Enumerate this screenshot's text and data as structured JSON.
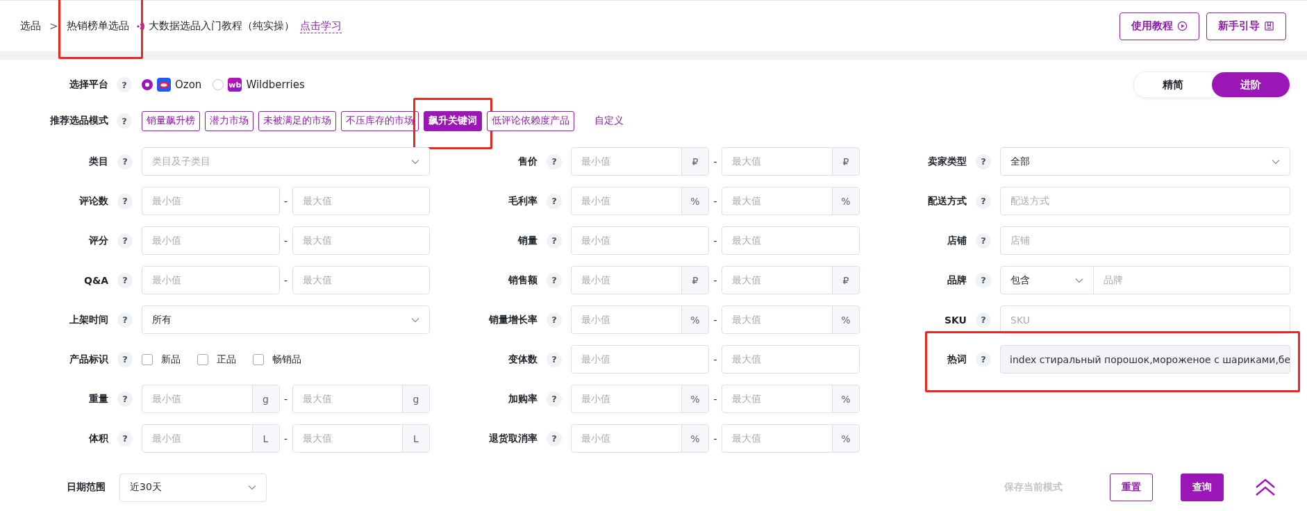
{
  "breadcrumb": {
    "items": [
      {
        "label": "选品",
        "highlighted": false
      },
      {
        "label": "热销榜单选品",
        "highlighted": true
      }
    ],
    "separator": ">"
  },
  "tutorial": {
    "title": "大数据选品入门教程（纯实操）",
    "link": "点击学习"
  },
  "header_buttons": [
    {
      "label": "使用教程",
      "kind": "play"
    },
    {
      "label": "新手引导",
      "kind": "guide"
    }
  ],
  "platform": {
    "label": "选择平台",
    "help": "?",
    "options": [
      {
        "name": "Ozon",
        "kind": "ozon",
        "selected": true
      },
      {
        "name": "Wildberries",
        "kind": "wb",
        "logo_text": "wb",
        "selected": false
      }
    ]
  },
  "view_toggle": [
    {
      "label": "精简",
      "selected": false
    },
    {
      "label": "进阶",
      "selected": true
    }
  ],
  "modes": {
    "label": "推荐选品模式",
    "help": "?",
    "items": [
      {
        "label": "销量飙升榜",
        "kind": "tag",
        "selected": false,
        "highlighted": false
      },
      {
        "label": "潜力市场",
        "kind": "tag",
        "selected": false,
        "highlighted": false
      },
      {
        "label": "未被满足的市场",
        "kind": "tag",
        "selected": false,
        "highlighted": false
      },
      {
        "label": "不压库存的市场",
        "kind": "tag",
        "selected": false,
        "highlighted": false
      },
      {
        "label": "飙升关键词",
        "kind": "tag",
        "selected": true,
        "highlighted": true
      },
      {
        "label": "低评论依赖度产品",
        "kind": "tag",
        "selected": false,
        "highlighted": false
      },
      {
        "label": "自定义",
        "kind": "link",
        "selected": false,
        "highlighted": false
      }
    ]
  },
  "filters": [
    {
      "rows": [
        {
          "label": "类目",
          "help": "?",
          "kind": "select",
          "placeholder": "类目及子类目"
        },
        {
          "label": "评论数",
          "help": "?",
          "kind": "range",
          "min": "最小值",
          "separator": "-",
          "max": "最大值"
        },
        {
          "label": "评分",
          "help": "?",
          "kind": "range",
          "min": "最小值",
          "separator": "-",
          "max": "最大值"
        },
        {
          "label": "Q&A",
          "help": "?",
          "kind": "range",
          "min": "最小值",
          "separator": "-",
          "max": "最大值"
        },
        {
          "label": "上架时间",
          "help": "?",
          "kind": "select",
          "value": "所有"
        },
        {
          "label": "产品标识",
          "help": "?",
          "kind": "checks",
          "options": [
            {
              "label": "新品",
              "checked": false
            },
            {
              "label": "正品",
              "checked": false
            },
            {
              "label": "畅销品",
              "checked": false
            }
          ]
        },
        {
          "label": "重量",
          "help": "?",
          "kind": "range",
          "min": "最小值",
          "min_unit": "g",
          "separator": "-",
          "max": "最大值",
          "max_unit": "g"
        },
        {
          "label": "体积",
          "help": "?",
          "kind": "range",
          "min": "最小值",
          "min_unit": "L",
          "separator": "-",
          "max": "最大值",
          "max_unit": "L"
        }
      ]
    },
    {
      "rows": [
        {
          "label": "售价",
          "help": "?",
          "kind": "range",
          "min": "最小值",
          "min_unit": "₽",
          "separator": "-",
          "max": "最大值",
          "max_unit": "₽"
        },
        {
          "label": "毛利率",
          "help": "?",
          "kind": "range",
          "min": "最小值",
          "min_unit": "%",
          "separator": "-",
          "max": "最大值",
          "max_unit": "%"
        },
        {
          "label": "销量",
          "help": "?",
          "kind": "range",
          "min": "最小值",
          "separator": "-",
          "max": "最大值"
        },
        {
          "label": "销售额",
          "help": "?",
          "kind": "range",
          "min": "最小值",
          "min_unit": "₽",
          "separator": "-",
          "max": "最大值",
          "max_unit": "₽"
        },
        {
          "label": "销量增长率",
          "help": "?",
          "kind": "range",
          "min": "最小值",
          "min_unit": "%",
          "separator": "-",
          "max": "最大值",
          "max_unit": "%"
        },
        {
          "label": "变体数",
          "help": "?",
          "kind": "range",
          "min": "最小值",
          "separator": "-",
          "max": "最大值"
        },
        {
          "label": "加购率",
          "help": "?",
          "kind": "range",
          "min": "最小值",
          "min_unit": "%",
          "separator": "-",
          "max": "最大值",
          "max_unit": "%"
        },
        {
          "label": "退货取消率",
          "help": "?",
          "kind": "range",
          "min": "最小值",
          "min_unit": "%",
          "separator": "-",
          "max": "最大值",
          "max_unit": "%"
        }
      ]
    },
    {
      "rows": [
        {
          "label": "卖家类型",
          "help": "?",
          "kind": "select",
          "value": "全部"
        },
        {
          "label": "配送方式",
          "help": "?",
          "kind": "text",
          "placeholder": "配送方式"
        },
        {
          "label": "店铺",
          "help": "?",
          "kind": "text",
          "placeholder": "店铺"
        },
        {
          "label": "品牌",
          "help": "?",
          "kind": "brand",
          "value": "包含",
          "placeholder": "品牌"
        },
        {
          "label": "SKU",
          "help": "?",
          "kind": "text",
          "placeholder": "SKU"
        },
        {
          "label": "热词",
          "help": "?",
          "kind": "readonly",
          "value": "index стиральный порошок,мороженое с шариками,бе",
          "highlighted": true
        }
      ]
    }
  ],
  "date_range": {
    "label": "日期范围",
    "value": "近30天"
  },
  "actions": [
    {
      "label": "保存当前模式",
      "kind": "muted"
    },
    {
      "label": "重置",
      "kind": "outline"
    },
    {
      "label": "查询",
      "kind": "primary"
    }
  ]
}
